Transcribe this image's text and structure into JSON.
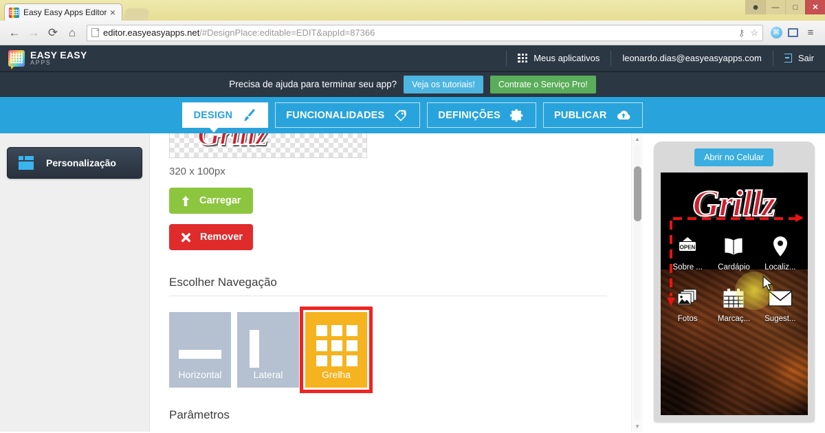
{
  "browser": {
    "tab_title": "Easy Easy Apps Editor",
    "tab_close": "×",
    "back_icon": "←",
    "forward_icon": "→",
    "reload_icon": "⟳",
    "home_icon": "⌂",
    "url_host": "editor.easyeasyapps.net",
    "url_path": "/#DesignPlace:editable=EDIT&appId=87366",
    "key_icon": "⚷",
    "star_icon": "☆",
    "ext_badge": "⌘",
    "menu_icon": "≡",
    "win_user": "὆4",
    "win_minimize": "—",
    "win_maximize": "□",
    "win_close": "✕"
  },
  "header": {
    "brand_main": "EASY EASY",
    "brand_sub": "APPS",
    "my_apps": "Meus aplicativos",
    "user_email": "leonardo.dias@easyeasyapps.com",
    "logout": "Sair"
  },
  "help_bar": {
    "message": "Precisa de ajuda para terminar seu app?",
    "tutorials_button": "Veja os tutoriais!",
    "pro_button": "Contrate o Serviço Pro!"
  },
  "tabs": [
    {
      "label": "DESIGN",
      "icon": "paintbrush-icon",
      "active": true
    },
    {
      "label": "FUNCIONALIDADES",
      "icon": "tags-icon",
      "active": false
    },
    {
      "label": "DEFINIÇÕES",
      "icon": "gear-icon",
      "active": false
    },
    {
      "label": "PUBLICAR",
      "icon": "cloud-upload-icon",
      "active": false
    }
  ],
  "sidebar": {
    "items": [
      {
        "label": "Personalização",
        "icon": "layout-icon"
      }
    ]
  },
  "panel": {
    "logo_text": "Grillz",
    "logo_size": "320 x 100px",
    "upload_button": "Carregar",
    "remove_button": "Remover",
    "navigation_heading": "Escolher Navegação",
    "nav_options": [
      {
        "label": "Horizontal",
        "selected": false
      },
      {
        "label": "Lateral",
        "selected": false
      },
      {
        "label": "Grelha",
        "selected": true
      }
    ],
    "params_heading": "Parâmetros"
  },
  "preview": {
    "open_mobile_button": "Abrir no Celular",
    "app_logo": "Grillz",
    "apps": [
      {
        "label": "Sobre ...",
        "icon": "open-sign-icon"
      },
      {
        "label": "Cardápio",
        "icon": "open-book-icon"
      },
      {
        "label": "Localiz...",
        "icon": "map-pin-icon"
      },
      {
        "label": "Fotos",
        "icon": "photos-stack-icon"
      },
      {
        "label": "Marcaç...",
        "icon": "calendar-icon"
      },
      {
        "label": "Sugest...",
        "icon": "envelope-icon"
      }
    ]
  },
  "colors": {
    "accent_blue": "#29a3dc",
    "header_dark": "#2c3744",
    "green": "#8cc63e",
    "red": "#e02b2b",
    "selected_gold": "#f5b320",
    "highlight_red": "#ef2424"
  }
}
